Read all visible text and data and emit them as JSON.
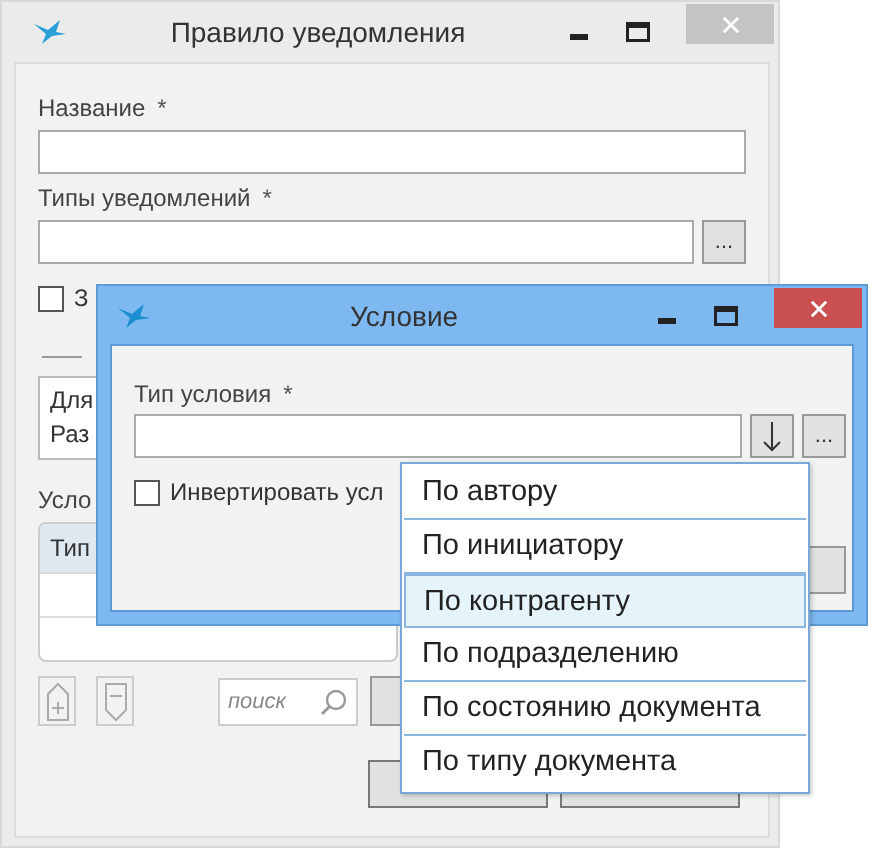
{
  "main_window": {
    "title": "Правило уведомления",
    "fields": [
      {
        "label": "Название",
        "mark": "*"
      },
      {
        "label": "Типы уведомлений",
        "mark": "*",
        "browse": "..."
      }
    ],
    "checkbox": {
      "label": "З",
      "checked": false
    },
    "group_lines": [
      "Для",
      "Раз"
    ],
    "conditions_label": "Усло",
    "table": {
      "column_1": "Тип"
    },
    "search": {
      "placeholder": "поиск"
    }
  },
  "dialog": {
    "title": "Условие",
    "field": {
      "label": "Тип условия",
      "mark": "*",
      "browse": "..."
    },
    "checkbox": {
      "label": "Инвертировать усл",
      "checked": false
    },
    "options": [
      {
        "label": "По автору",
        "selected": false
      },
      {
        "label": "По инициатору",
        "selected": false
      },
      {
        "label": "По контрагенту",
        "selected": true
      },
      {
        "label": "По подразделению",
        "selected": false
      },
      {
        "label": "По состоянию документа",
        "selected": false
      },
      {
        "label": "По типу документа",
        "selected": false
      }
    ]
  }
}
